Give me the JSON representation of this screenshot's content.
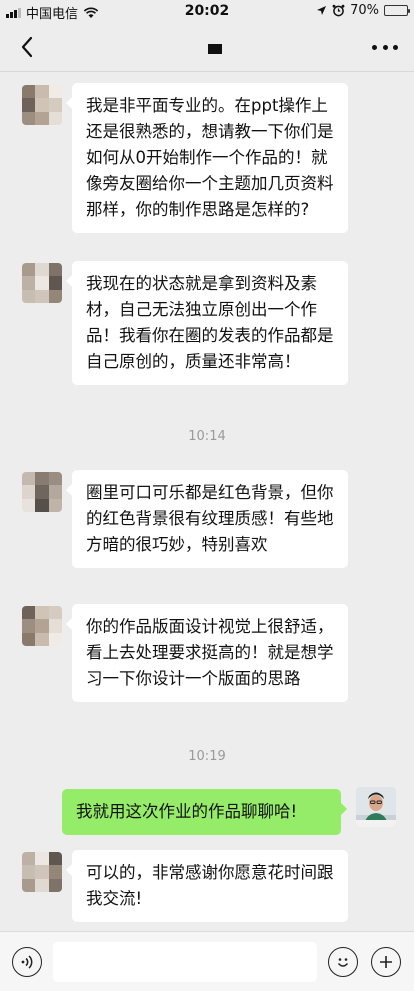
{
  "status_bar": {
    "carrier": "中国电信",
    "time": "20:02",
    "battery": "70%",
    "battery_level": 0.7
  },
  "nav": {
    "back_icon": "chevron-left-icon",
    "more_icon": "more-dots-icon"
  },
  "messages": [
    {
      "side": "left",
      "text": "我是非平面专业的。在ppt操作上还是很熟悉的，想请教一下你们是如何从0开始制作一个作品的！就像旁友圈给你一个主题加几页资料那样，你的制作思路是怎样的?"
    },
    {
      "side": "left",
      "text": "我现在的状态就是拿到资料及素材，自己无法独立原创出一个作品！我看你在圈的发表的作品都是自己原创的，质量还非常高！"
    },
    {
      "time": "10:14"
    },
    {
      "side": "left",
      "text": "圈里可口可乐都是红色背景，但你的红色背景很有纹理质感！有些地方暗的很巧妙，特别喜欢"
    },
    {
      "side": "left",
      "text": "你的作品版面设计视觉上很舒适，看上去处理要求挺高的！就是想学习一下你设计一个版面的思路"
    },
    {
      "time": "10:19"
    },
    {
      "side": "right",
      "text": "我就用这次作业的作品聊聊哈!"
    },
    {
      "side": "left",
      "text": "可以的，非常感谢你愿意花时间跟我交流!"
    }
  ],
  "input_bar": {
    "voice_icon": "voice-icon",
    "emoji_icon": "emoji-icon",
    "plus_icon": "plus-icon",
    "input_value": ""
  }
}
